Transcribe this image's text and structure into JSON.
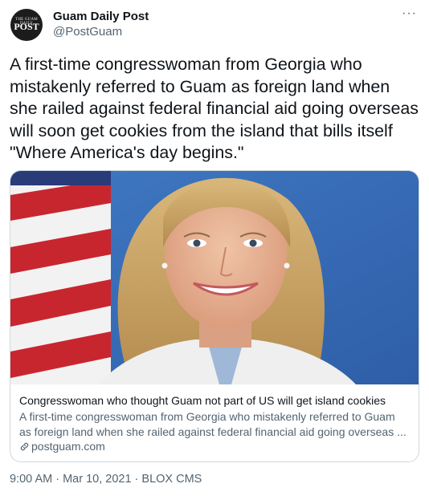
{
  "account": {
    "avatar_top": "THE GUAM DAILY",
    "avatar_main": "POST",
    "name": "Guam Daily Post",
    "handle": "@PostGuam"
  },
  "menu_icon": "ellipsis-icon",
  "tweet_text": "A first-time congresswoman from Georgia who mistakenly referred to Guam as foreign land when she railed against federal financial aid going overseas will soon get cookies from the island that bills itself \"Where America's day begins.\"",
  "card": {
    "title": "Congresswoman who thought Guam not part of US will get island cookies",
    "description": "A first-time congresswoman from Georgia who mistakenly referred to Guam as foreign land when she railed against federal financial aid going overseas ...",
    "domain": "postguam.com",
    "link_icon": "link-icon"
  },
  "meta": "9:00 AM · Mar 10, 2021 · BLOX CMS"
}
